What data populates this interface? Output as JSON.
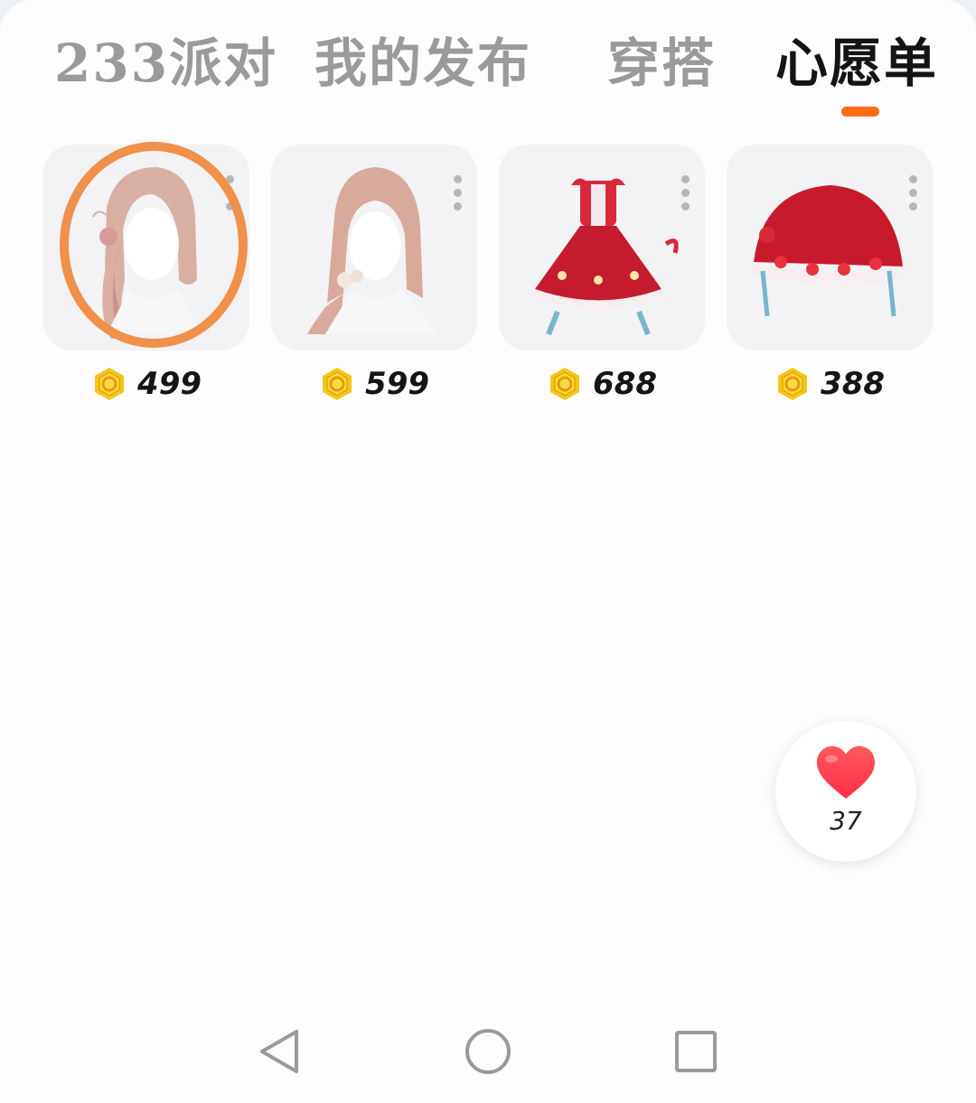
{
  "tabs": [
    {
      "label": "233派对",
      "active": false
    },
    {
      "label": "我的发布",
      "active": false
    },
    {
      "label": "穿搭",
      "active": false
    },
    {
      "label": "心愿单",
      "active": true
    }
  ],
  "accent_color": "#ff6a16",
  "highlight_color": "#f0904a",
  "items": [
    {
      "price": "499",
      "image": "pink-hair-side-ponytail",
      "currency_icon": "gold-g-coin-icon"
    },
    {
      "price": "599",
      "image": "pink-hair-low-twin-tails",
      "currency_icon": "gold-g-coin-icon"
    },
    {
      "price": "688",
      "image": "red-lolita-dress",
      "currency_icon": "gold-g-coin-icon"
    },
    {
      "price": "388",
      "image": "red-strawberry-hat",
      "currency_icon": "gold-g-coin-icon"
    }
  ],
  "like_button": {
    "count": "37",
    "icon": "heart-icon"
  },
  "navbar": {
    "back_icon": "back-triangle-icon",
    "home_icon": "home-circle-icon",
    "recent_icon": "recent-square-icon"
  }
}
